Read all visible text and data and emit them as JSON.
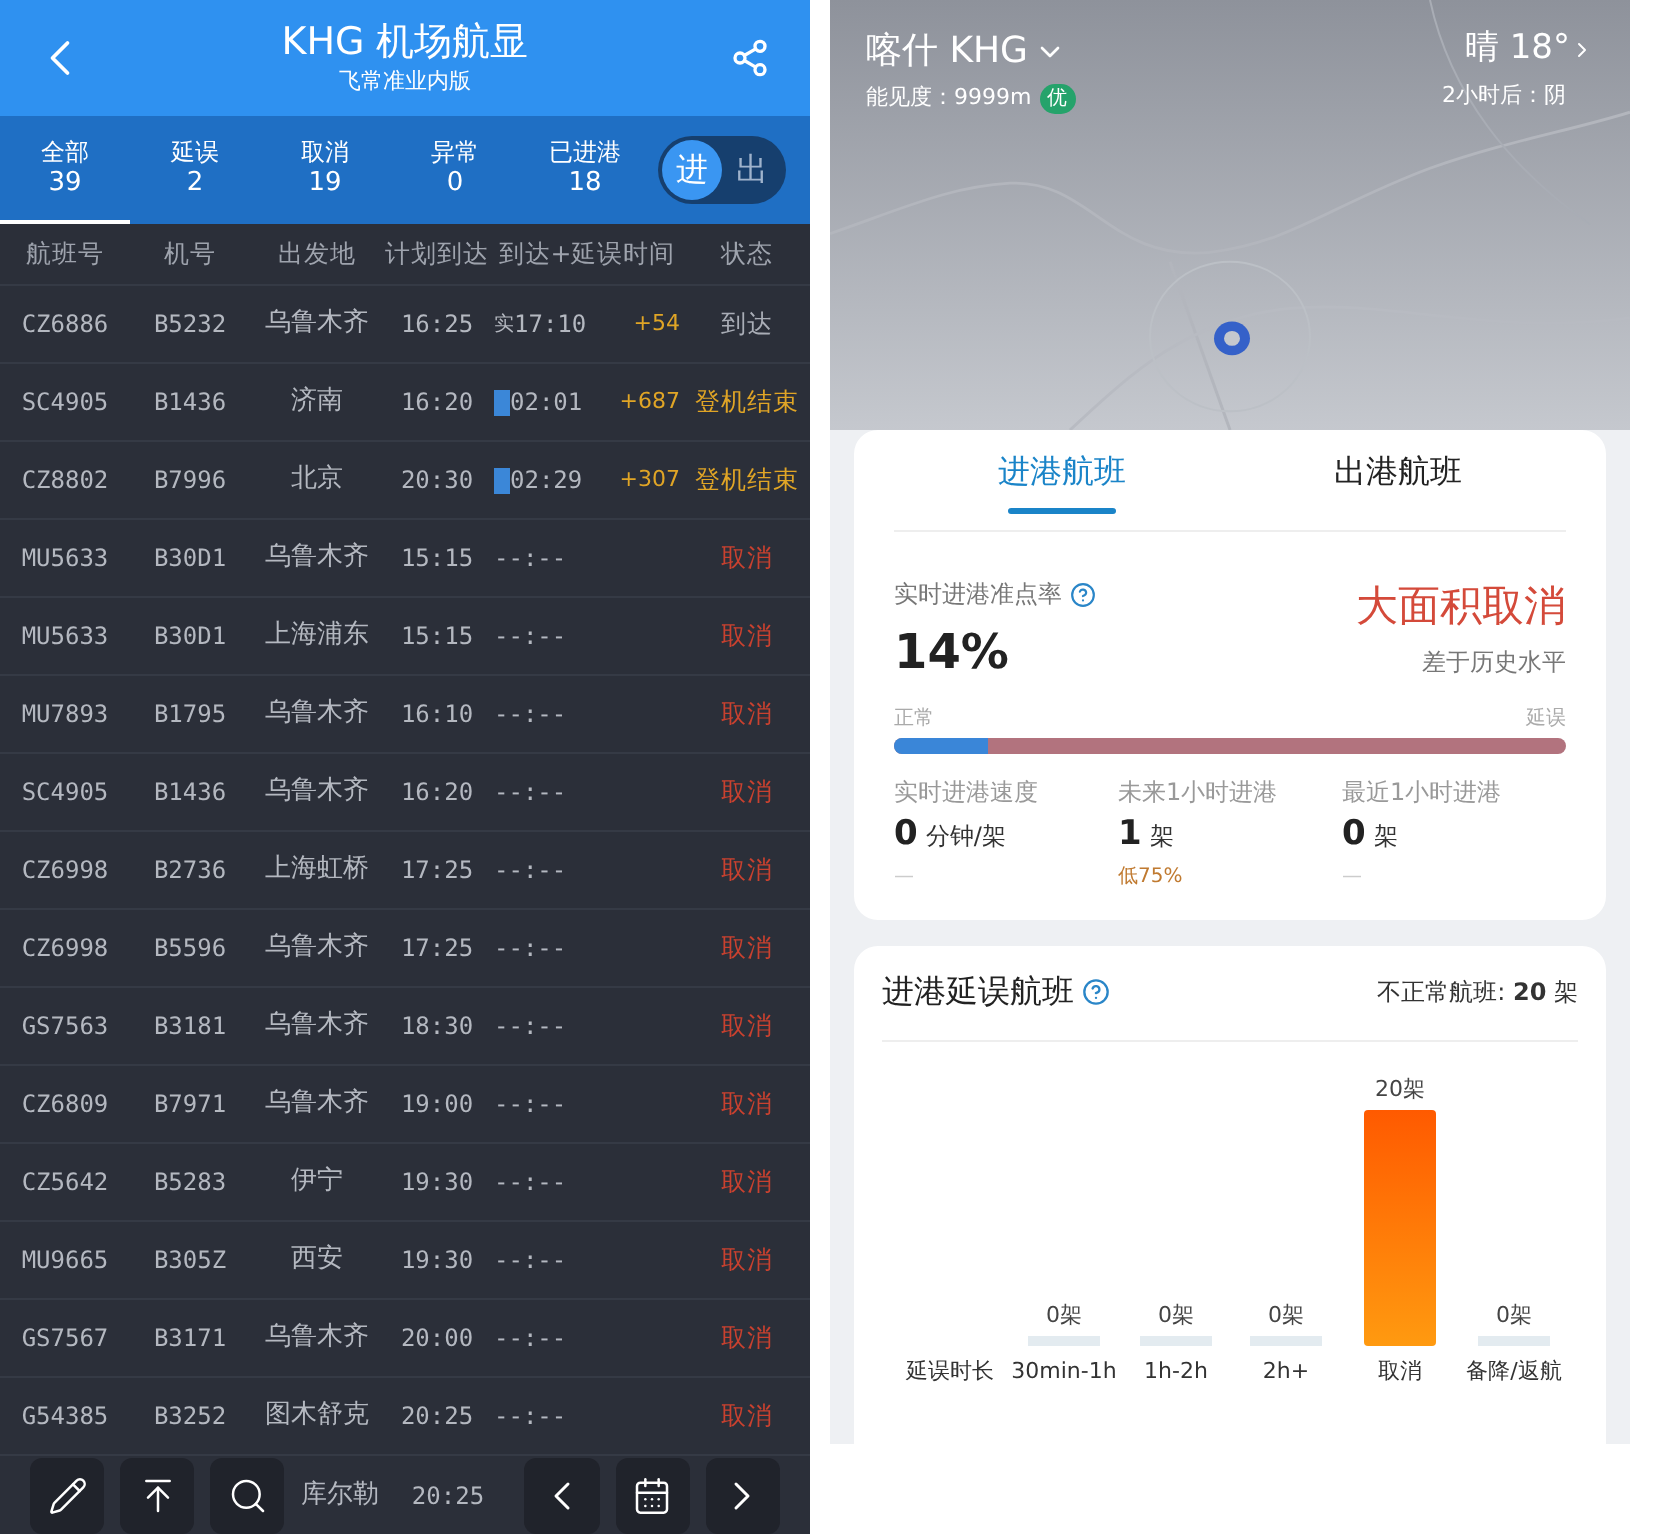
{
  "left": {
    "header": {
      "title": "KHG 机场航显",
      "subtitle": "飞常准业内版"
    },
    "filters": [
      {
        "label": "全部",
        "count": "39",
        "selected": true
      },
      {
        "label": "延误",
        "count": "2",
        "selected": false
      },
      {
        "label": "取消",
        "count": "19",
        "selected": false
      },
      {
        "label": "异常",
        "count": "0",
        "selected": false
      },
      {
        "label": "已进港",
        "count": "18",
        "selected": false
      }
    ],
    "direction": [
      {
        "label": "进",
        "selected": true
      },
      {
        "label": "出",
        "selected": false
      }
    ],
    "columns": [
      "航班号",
      "机号",
      "出发地",
      "计划到达",
      "到达+延误时间",
      "状态"
    ],
    "rows": [
      {
        "flight": "CZ6886",
        "aircraft": "B5232",
        "origin": "乌鲁木齐",
        "scheduled": "16:25",
        "arrival_prefix": "实",
        "estimated": false,
        "arrival": "17:10",
        "delay": "+54",
        "status": "到达",
        "kind": "arrived"
      },
      {
        "flight": "SC4905",
        "aircraft": "B1436",
        "origin": "济南",
        "scheduled": "16:20",
        "estimated": true,
        "arrival": "02:01",
        "delay": "+687",
        "status": "登机结束",
        "kind": "boarding"
      },
      {
        "flight": "CZ8802",
        "aircraft": "B7996",
        "origin": "北京",
        "scheduled": "20:30",
        "estimated": true,
        "arrival": "02:29",
        "delay": "+307",
        "status": "登机结束",
        "kind": "boarding"
      },
      {
        "flight": "MU5633",
        "aircraft": "B30D1",
        "origin": "乌鲁木齐",
        "scheduled": "15:15",
        "estimated": false,
        "arrival": "--:--",
        "status": "取消",
        "kind": "cancelled"
      },
      {
        "flight": "MU5633",
        "aircraft": "B30D1",
        "origin": "上海浦东",
        "scheduled": "15:15",
        "estimated": false,
        "arrival": "--:--",
        "status": "取消",
        "kind": "cancelled"
      },
      {
        "flight": "MU7893",
        "aircraft": "B1795",
        "origin": "乌鲁木齐",
        "scheduled": "16:10",
        "estimated": false,
        "arrival": "--:--",
        "status": "取消",
        "kind": "cancelled"
      },
      {
        "flight": "SC4905",
        "aircraft": "B1436",
        "origin": "乌鲁木齐",
        "scheduled": "16:20",
        "estimated": false,
        "arrival": "--:--",
        "status": "取消",
        "kind": "cancelled"
      },
      {
        "flight": "CZ6998",
        "aircraft": "B2736",
        "origin": "上海虹桥",
        "scheduled": "17:25",
        "estimated": false,
        "arrival": "--:--",
        "status": "取消",
        "kind": "cancelled"
      },
      {
        "flight": "CZ6998",
        "aircraft": "B5596",
        "origin": "乌鲁木齐",
        "scheduled": "17:25",
        "estimated": false,
        "arrival": "--:--",
        "status": "取消",
        "kind": "cancelled"
      },
      {
        "flight": "GS7563",
        "aircraft": "B3181",
        "origin": "乌鲁木齐",
        "scheduled": "18:30",
        "estimated": false,
        "arrival": "--:--",
        "status": "取消",
        "kind": "cancelled"
      },
      {
        "flight": "CZ6809",
        "aircraft": "B7971",
        "origin": "乌鲁木齐",
        "scheduled": "19:00",
        "estimated": false,
        "arrival": "--:--",
        "status": "取消",
        "kind": "cancelled"
      },
      {
        "flight": "CZ5642",
        "aircraft": "B5283",
        "origin": "伊宁",
        "scheduled": "19:30",
        "estimated": false,
        "arrival": "--:--",
        "status": "取消",
        "kind": "cancelled"
      },
      {
        "flight": "MU9665",
        "aircraft": "B305Z",
        "origin": "西安",
        "scheduled": "19:30",
        "estimated": false,
        "arrival": "--:--",
        "status": "取消",
        "kind": "cancelled"
      },
      {
        "flight": "GS7567",
        "aircraft": "B3171",
        "origin": "乌鲁木齐",
        "scheduled": "20:00",
        "estimated": false,
        "arrival": "--:--",
        "status": "取消",
        "kind": "cancelled"
      },
      {
        "flight": "G54385",
        "aircraft": "B3252",
        "origin": "图木舒克",
        "scheduled": "20:25",
        "estimated": false,
        "arrival": "--:--",
        "status": "取消",
        "kind": "cancelled"
      }
    ],
    "last_row": {
      "origin": "库尔勒",
      "scheduled": "20:25"
    }
  },
  "right": {
    "airport": "喀什 KHG",
    "visibility": "能见度：9999m",
    "visibility_badge": "优",
    "weather": "晴 18°",
    "forecast": "2小时后：阴",
    "tabs": [
      {
        "label": "进港航班",
        "selected": true
      },
      {
        "label": "出港航班",
        "selected": false
      }
    ],
    "punctuality": {
      "label": "实时进港准点率",
      "value": "14%",
      "status": "大面积取消",
      "comparison": "差于历史水平",
      "normal": "正常",
      "delay": "延误",
      "level": 0.14
    },
    "stats": [
      {
        "label": "实时进港速度",
        "value": "0",
        "unit": "分钟/架",
        "note": "—",
        "kind": "plain"
      },
      {
        "label": "未来1小时进港",
        "value": "1",
        "unit": "架",
        "note": "低75%",
        "kind": "warn"
      },
      {
        "label": "最近1小时进港",
        "value": "0",
        "unit": "架",
        "note": "—",
        "kind": "plain"
      }
    ],
    "delays": {
      "title": "进港延误航班",
      "summary": "不正常航班: **20** 架",
      "chart_data": {
        "type": "bar",
        "xlabel": "延误时长",
        "categories": [
          "30min-1h",
          "1h-2h",
          "2h+",
          "取消",
          "备降/返航"
        ],
        "values": [
          0,
          0,
          0,
          20,
          0
        ],
        "value_labels": [
          "0架",
          "0架",
          "0架",
          "20架",
          "0架"
        ]
      }
    }
  }
}
